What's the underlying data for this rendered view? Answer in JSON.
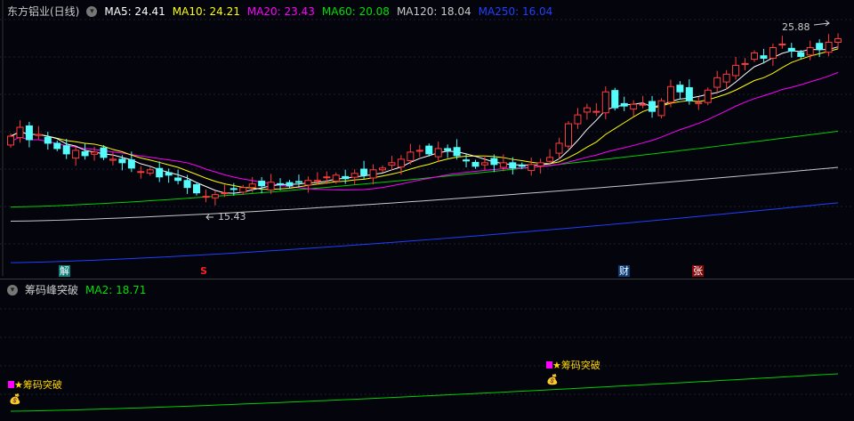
{
  "header": {
    "title": "东方铝业(日线)",
    "ma": [
      {
        "label": "MA5: 24.41",
        "color": "#ffffff"
      },
      {
        "label": "MA10: 24.21",
        "color": "#ffff00"
      },
      {
        "label": "MA20: 23.43",
        "color": "#ff00ff"
      },
      {
        "label": "MA60: 20.08",
        "color": "#00e000"
      },
      {
        "label": "MA120: 18.04",
        "color": "#c8c8c8"
      },
      {
        "label": "MA250: 16.04",
        "color": "#2040ff"
      }
    ]
  },
  "annotations": {
    "high": "25.88",
    "low": "15.43"
  },
  "events": {
    "jie": "解",
    "s": "S",
    "cai": "财",
    "zhang": "张"
  },
  "sub": {
    "title": "筹码峰突破",
    "ma2": "MA2: 18.71",
    "signal": "筹码突破",
    "signal2": "筹码突破"
  },
  "chart_data": {
    "type": "candlestick",
    "closes": [
      19.8,
      20.3,
      19.6,
      19.9,
      19.4,
      19.1,
      18.8,
      19.0,
      18.7,
      18.9,
      18.6,
      18.5,
      18.3,
      18.0,
      17.8,
      17.9,
      17.5,
      17.6,
      17.3,
      16.9,
      16.6,
      16.4,
      16.5,
      16.6,
      16.8,
      16.9,
      17.1,
      17.0,
      17.2,
      17.1,
      17.0,
      17.2,
      17.3,
      17.3,
      17.5,
      17.6,
      17.4,
      17.7,
      17.6,
      17.9,
      18.0,
      18.3,
      18.5,
      18.9,
      19.0,
      18.8,
      19.1,
      19.0,
      18.7,
      18.4,
      18.1,
      18.3,
      18.2,
      18.3,
      18.0,
      18.1,
      18.2,
      18.3,
      18.6,
      19.4,
      20.5,
      21.0,
      21.4,
      21.2,
      22.3,
      21.4,
      21.5,
      21.6,
      21.6,
      21.2,
      21.8,
      22.6,
      22.3,
      21.8,
      21.7,
      22.4,
      23.1,
      23.3,
      23.8,
      23.9,
      24.5,
      24.2,
      24.8,
      25.0,
      24.6,
      24.3,
      24.8,
      24.7,
      25.1,
      25.3
    ],
    "ma60_range": [
      15.8,
      20.08
    ],
    "ma120_range": [
      15.0,
      18.04
    ],
    "ma250_range": [
      12.66,
      16.04
    ],
    "ma2_range": [
      14.0,
      16.9
    ]
  }
}
